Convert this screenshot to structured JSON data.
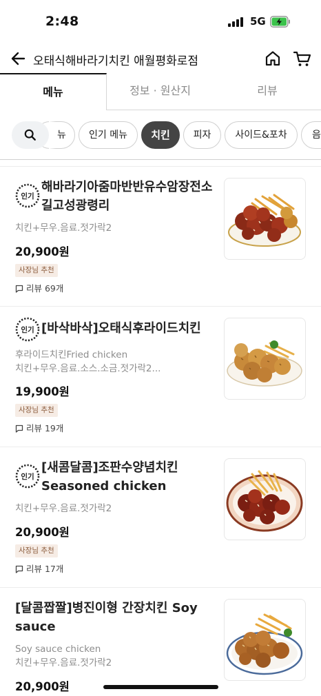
{
  "status": {
    "time": "2:48",
    "network": "5G"
  },
  "header": {
    "title": "오태식해바라기치킨 애월평화로점"
  },
  "tabs": [
    {
      "label": "메뉴",
      "active": true
    },
    {
      "label": "정보 · 원산지",
      "active": false
    },
    {
      "label": "리뷰",
      "active": false
    }
  ],
  "chips": [
    {
      "label": "뉴",
      "active": false
    },
    {
      "label": "인기 메뉴",
      "active": false
    },
    {
      "label": "치킨",
      "active": true
    },
    {
      "label": "피자",
      "active": false
    },
    {
      "label": "사이드&포차",
      "active": false
    },
    {
      "label": "음",
      "active": false
    }
  ],
  "menu_items": [
    {
      "popular_badge": "인기",
      "name_line1": "해바라기아줌마반반유수암장전소",
      "name_line2": "길고성광령리",
      "desc_line1": "치킨+무우.음료.젓가락2",
      "desc_line2": "",
      "price": "20,900원",
      "owner_badge": "사장님 추천",
      "review": "리뷰 69개"
    },
    {
      "popular_badge": "인기",
      "name_line1": "[바삭바삭]오태식후라이드치킨",
      "name_line2": "",
      "desc_line1": "후라이드치킨Fried chicken",
      "desc_line2": "치킨+무우.음료.소스.소금.젓가락2...",
      "price": "19,900원",
      "owner_badge": "사장님 추천",
      "review": "리뷰 19개"
    },
    {
      "popular_badge": "인기",
      "name_line1": "[새콤달콤]조판수양념치킨",
      "name_line2": "Seasoned chicken",
      "desc_line1": "치킨+무우.음료.젓가락2",
      "desc_line2": "",
      "price": "20,900원",
      "owner_badge": "사장님 추천",
      "review": "리뷰 17개"
    },
    {
      "popular_badge": "",
      "name_line1": "[달콤짭짤]병진이형 간장치킨 Soy",
      "name_line2": "sauce",
      "desc_line1": "Soy sauce chicken",
      "desc_line2": "치킨+무우.음료.젓가락2",
      "price": "20,900원",
      "owner_badge": "",
      "review": ""
    }
  ],
  "icons": {
    "back": "back-arrow-icon",
    "home": "home-icon",
    "cart": "cart-icon",
    "search": "search-icon",
    "review": "comment-icon",
    "popular": "popular-badge-icon"
  }
}
